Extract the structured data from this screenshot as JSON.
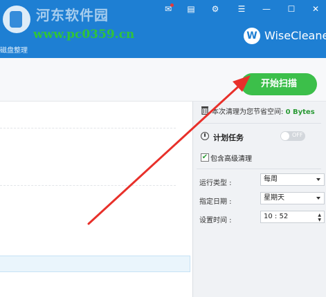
{
  "header": {
    "watermark_title": "河东软件园",
    "watermark_url": "www.pc0359.cn",
    "breadcrumb": "磁盘整理",
    "brand": "WiseCleaner",
    "brand_logo": "W",
    "window_controls": [
      "notification-icon",
      "feedback-icon",
      "skin-icon",
      "menu-icon",
      "minimize-icon",
      "maximize-icon",
      "close-icon"
    ]
  },
  "toolbar": {
    "scan_button": "开始扫描"
  },
  "right_panel": {
    "savings_label": "本次清理为您节省空间:",
    "savings_value": "0 Bytes",
    "schedule_label": "计划任务",
    "toggle_text": "OFF",
    "advanced_label": "包含高级清理",
    "advanced_checked": "✔",
    "run_type_label": "运行类型 :",
    "run_type_value": "每周",
    "date_label": "指定日期 :",
    "date_value": "星期天",
    "time_label": "设置时间 :",
    "time_value": "10 : 52"
  },
  "colors": {
    "header_blue": "#1e7fd3",
    "scan_green": "#3cbf4a",
    "annotation_red": "#e8302a"
  }
}
